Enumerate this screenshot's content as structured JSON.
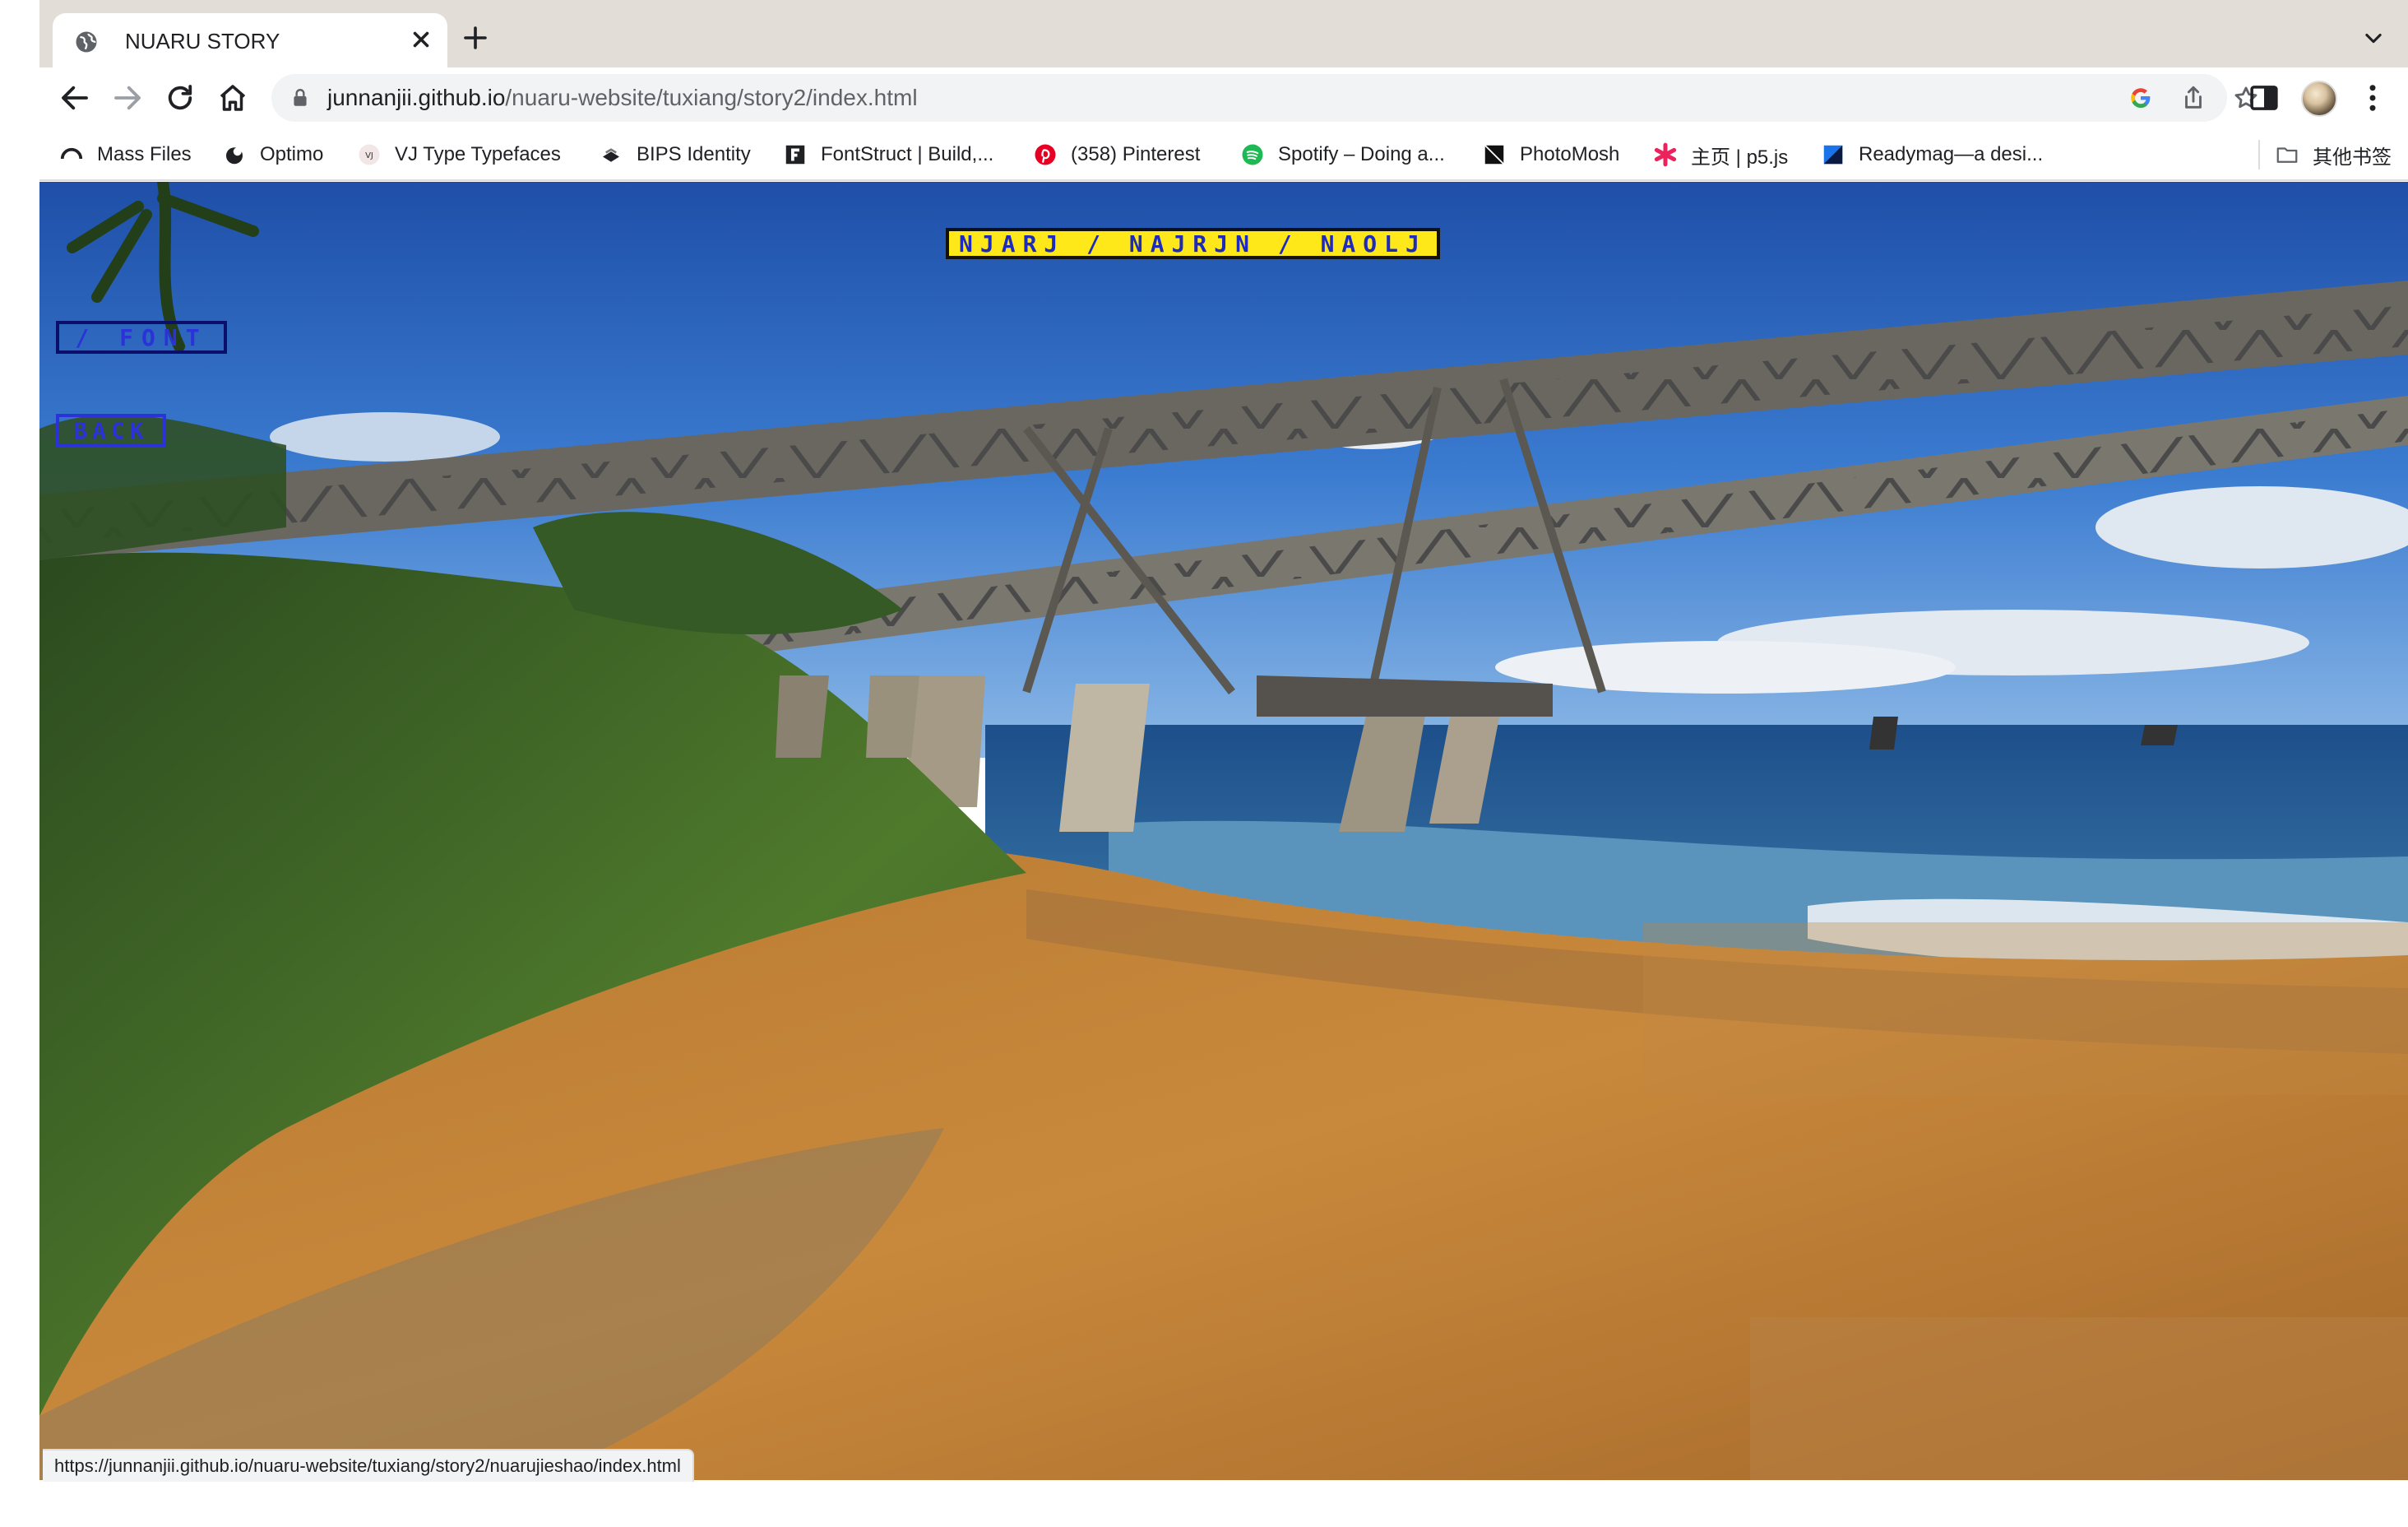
{
  "tab": {
    "title": "NUARU STORY"
  },
  "address_bar": {
    "host": "junnanjii.github.io",
    "path": "/nuaru-website/tuxiang/story2/index.html"
  },
  "bookmarks": [
    {
      "label": "Mass Files",
      "icon": "arc-icon"
    },
    {
      "label": "Optimo",
      "icon": "optimo-icon"
    },
    {
      "label": "VJ Type Typefaces",
      "icon": "vj-icon"
    },
    {
      "label": "BIPS Identity",
      "icon": "bips-icon"
    },
    {
      "label": "FontStruct | Build,...",
      "icon": "fontstruct-icon"
    },
    {
      "label": "(358) Pinterest",
      "icon": "pinterest-icon"
    },
    {
      "label": "Spotify – Doing a...",
      "icon": "spotify-icon"
    },
    {
      "label": "PhotoMosh",
      "icon": "photomosh-icon"
    },
    {
      "label": "主页 | p5.js",
      "icon": "p5-icon"
    },
    {
      "label": "Readymag—a desi...",
      "icon": "readymag-icon"
    }
  ],
  "other_bookmarks": "其他书签",
  "page": {
    "title_banner": "NJARJ / NAJRJN / NAOLJ",
    "font_link": "/ FONT",
    "back_link": "BACK"
  },
  "status_url": "https://junnanjii.github.io/nuaru-website/tuxiang/story2/nuarujieshao/index.html",
  "colors": {
    "banner_bg": "#ffe81a",
    "banner_text": "#1d2bbd",
    "link_blue": "#2a32d8",
    "tab_strip": "#e3ddd8"
  }
}
